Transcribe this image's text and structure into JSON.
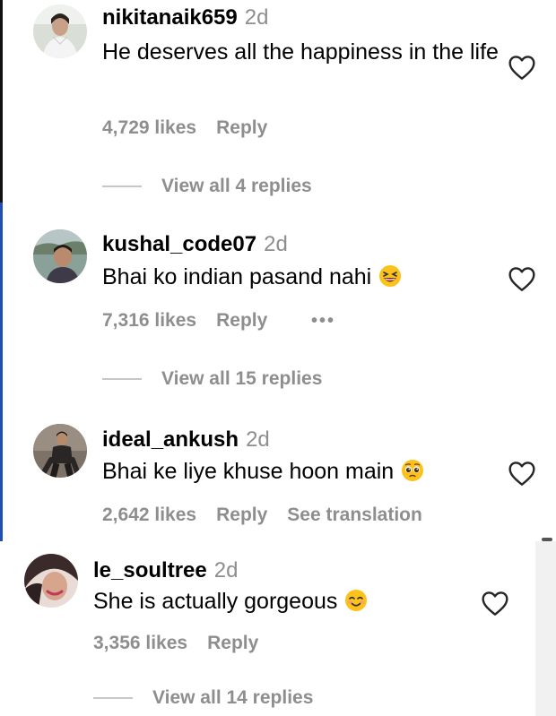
{
  "comments": [
    {
      "username": "nikitanaik659",
      "time": "2d",
      "text": "He deserves all the happiness in the life",
      "likes": "4,729 likes",
      "reply": "Reply",
      "view_replies": "View all 4 replies"
    },
    {
      "username": "kushal_code07",
      "time": "2d",
      "text": "Bhai ko indian pasand nahi",
      "emoji": "grinning-squinting-face",
      "likes": "7,316 likes",
      "reply": "Reply",
      "more": "•••",
      "view_replies": "View all 15 replies"
    },
    {
      "username": "ideal_ankush",
      "time": "2d",
      "text": "Bhai ke liye khuse hoon main",
      "emoji": "pleading-face",
      "likes": "2,642 likes",
      "reply": "Reply",
      "translate": "See translation"
    },
    {
      "username": "le_soultree",
      "time": "2d",
      "text": "She is actually gorgeous",
      "emoji": "smiling-face",
      "likes": "3,356 likes",
      "reply": "Reply",
      "view_replies": "View all 14 replies"
    }
  ],
  "colors": {
    "secondary_text": "#8e8e8e",
    "left_edge_top": "#111111",
    "left_edge_bottom": "#1f4fb0"
  }
}
